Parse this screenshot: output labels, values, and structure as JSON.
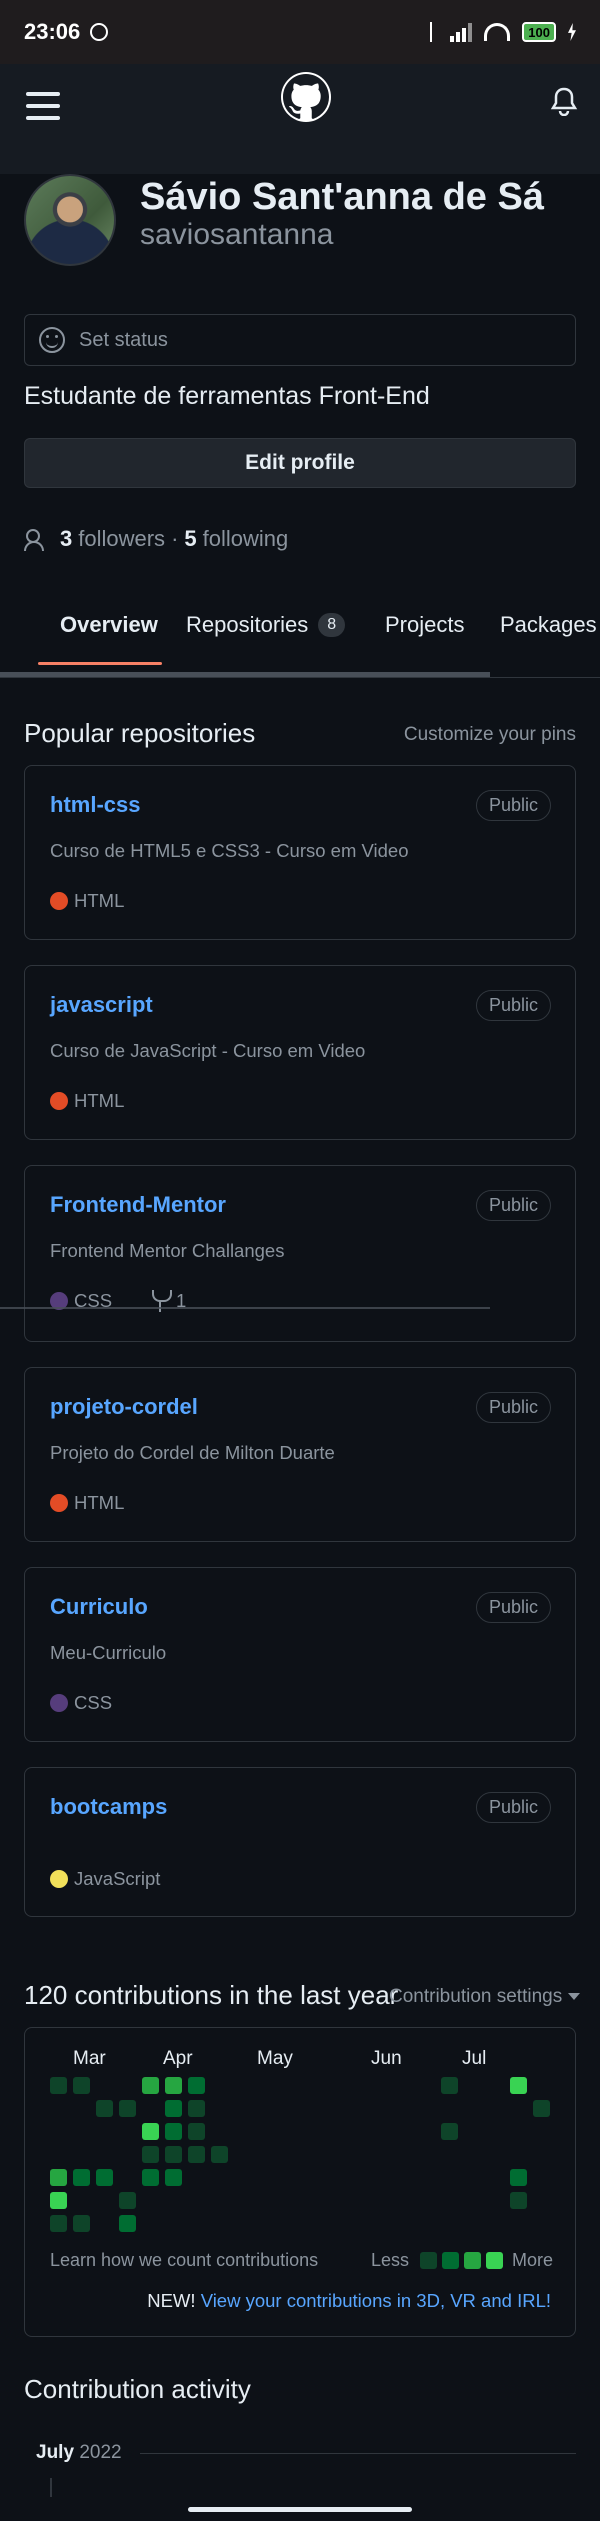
{
  "status_bar": {
    "time": "23:06",
    "battery": "100"
  },
  "profile": {
    "full_name": "Sávio Sant'anna de Sá",
    "username": "saviosantanna",
    "set_status": "Set status",
    "bio": "Estudante de ferramentas Front-End",
    "edit_profile": "Edit profile",
    "followers_count": "3",
    "followers_label": "followers",
    "separator": "·",
    "following_count": "5",
    "following_label": "following"
  },
  "tabs": {
    "overview": "Overview",
    "repositories": "Repositories",
    "repositories_count": "8",
    "projects": "Projects",
    "packages": "Packages"
  },
  "popular": {
    "title": "Popular repositories",
    "customize": "Customize your pins",
    "repos": [
      {
        "name": "html-css",
        "visibility": "Public",
        "description": "Curso de HTML5 e CSS3 - Curso em Video",
        "language": "HTML",
        "lang_color": "#e34c26"
      },
      {
        "name": "javascript",
        "visibility": "Public",
        "description": "Curso de JavaScript - Curso em Video",
        "language": "HTML",
        "lang_color": "#e34c26"
      },
      {
        "name": "Frontend-Mentor",
        "visibility": "Public",
        "description": "Frontend Mentor Challanges",
        "language": "CSS",
        "lang_color": "#563d7c",
        "forks": "1"
      },
      {
        "name": "projeto-cordel",
        "visibility": "Public",
        "description": "Projeto do Cordel de Milton Duarte",
        "language": "HTML",
        "lang_color": "#e34c26"
      },
      {
        "name": "Curriculo",
        "visibility": "Public",
        "description": "Meu-Curriculo",
        "language": "CSS",
        "lang_color": "#563d7c"
      },
      {
        "name": "bootcamps",
        "visibility": "Public",
        "description": "",
        "language": "JavaScript",
        "lang_color": "#f1e05a"
      }
    ]
  },
  "contributions": {
    "title": "120 contributions in the last year",
    "settings": "Contribution settings",
    "months": [
      "Mar",
      "Apr",
      "May",
      "Jun",
      "Jul"
    ],
    "learn": "Learn how we count contributions",
    "less": "Less",
    "more": "More",
    "new_prefix": "NEW!",
    "new_link": "View your contributions in 3D, VR and IRL!",
    "level_colors": [
      "#161b22",
      "#0e4429",
      "#006d32",
      "#26a641",
      "#39d353"
    ]
  },
  "activity": {
    "title": "Contribution activity",
    "month": "July",
    "year": "2022"
  }
}
